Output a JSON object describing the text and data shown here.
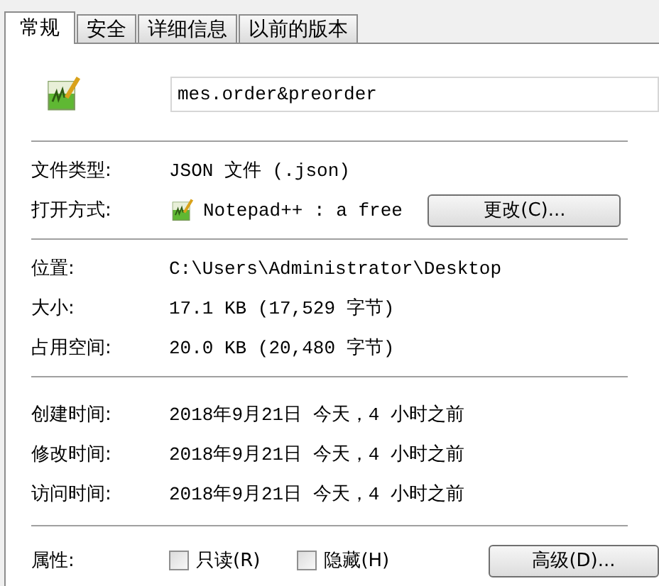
{
  "tabs": [
    {
      "label": "常规",
      "selected": true
    },
    {
      "label": "安全",
      "selected": false
    },
    {
      "label": "详细信息",
      "selected": false
    },
    {
      "label": "以前的版本",
      "selected": false
    }
  ],
  "file_name": {
    "value": "mes.order&preorder"
  },
  "type_rows": [
    {
      "label": "文件类型:",
      "value": "JSON 文件 (.json)"
    },
    {
      "label": "打开方式:",
      "value": "Notepad++ : a free",
      "button": "更改(C)..."
    }
  ],
  "location_rows": [
    {
      "label": "位置:",
      "value": "C:\\Users\\Administrator\\Desktop"
    },
    {
      "label": "大小:",
      "value": "17.1 KB (17,529 字节)"
    },
    {
      "label": "占用空间:",
      "value": "20.0 KB (20,480 字节)"
    }
  ],
  "time_rows": [
    {
      "label": "创建时间:",
      "value": "2018年9月21日 今天，4 小时之前"
    },
    {
      "label": "修改时间:",
      "value": "2018年9月21日 今天，4 小时之前"
    },
    {
      "label": "访问时间:",
      "value": "2018年9月21日 今天，4 小时之前"
    }
  ],
  "attributes": {
    "label": "属性:",
    "checkboxes": [
      {
        "label": "只读(R)",
        "checked": false
      },
      {
        "label": "隐藏(H)",
        "checked": false
      }
    ],
    "button": "高级(D)..."
  }
}
